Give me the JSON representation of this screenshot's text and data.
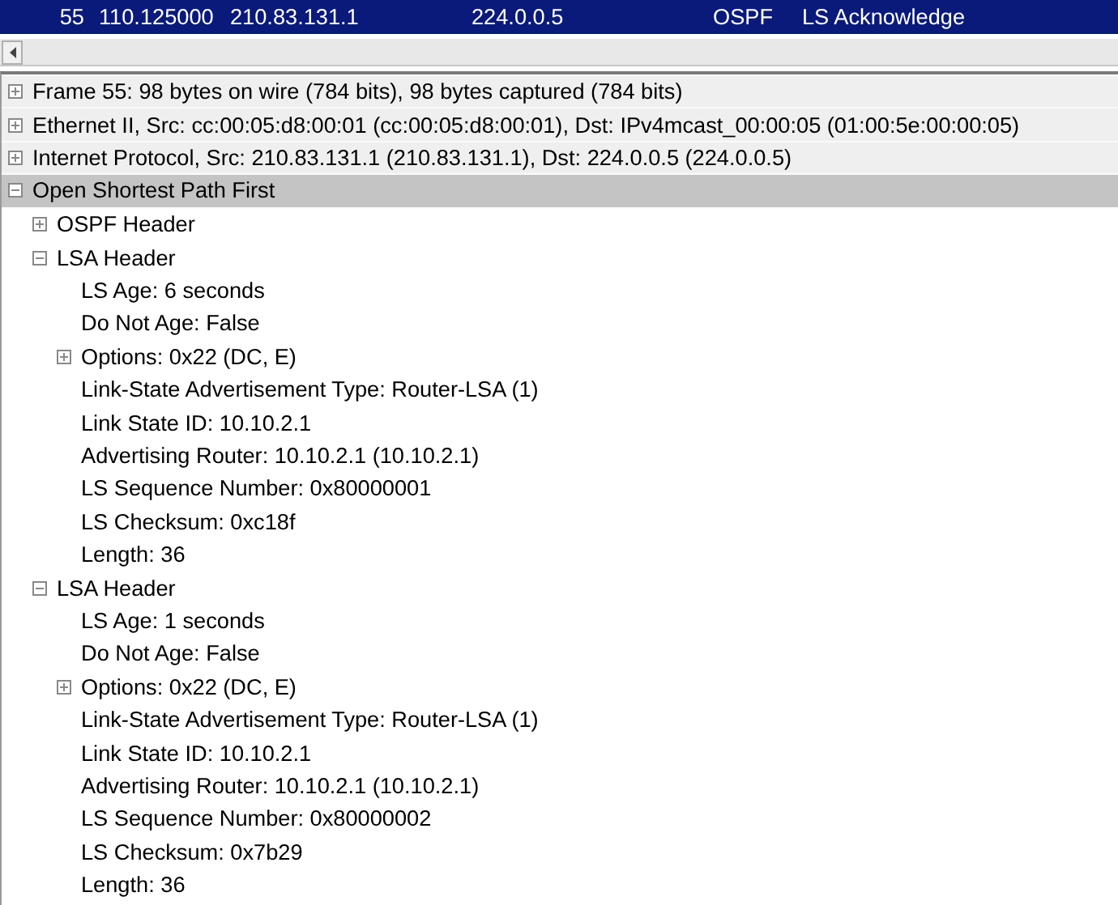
{
  "packet_list": {
    "rows": [
      {
        "cells": [
          "55",
          "110.125000",
          "210.83.131.1",
          "224.0.0.5",
          "OSPF",
          "LS Acknowledge"
        ],
        "selected": true
      }
    ]
  },
  "details_tree": {
    "items": [
      {
        "label": "Frame 55: 98 bytes on wire (784 bits), 98 bytes captured (784 bits)",
        "expanded": false,
        "selected": false
      },
      {
        "label": "Ethernet II, Src: cc:00:05:d8:00:01 (cc:00:05:d8:00:01), Dst: IPv4mcast_00:00:05 (01:00:5e:00:00:05)",
        "expanded": false,
        "selected": false
      },
      {
        "label": "Internet Protocol, Src: 210.83.131.1 (210.83.131.1), Dst: 224.0.0.5 (224.0.0.5)",
        "expanded": false,
        "selected": false
      },
      {
        "label": "Open Shortest Path First",
        "expanded": true,
        "selected": true,
        "children": [
          {
            "label": "OSPF Header",
            "expanded": false,
            "selected": false
          },
          {
            "label": "LSA Header",
            "expanded": true,
            "selected": false,
            "children": [
              {
                "label": "LS Age: 6 seconds",
                "selected": false
              },
              {
                "label": "Do Not Age: False",
                "selected": false
              },
              {
                "label": "Options: 0x22 (DC, E)",
                "expanded": false,
                "selected": false
              },
              {
                "label": "Link-State Advertisement Type: Router-LSA (1)",
                "selected": false
              },
              {
                "label": "Link State ID: 10.10.2.1",
                "selected": false
              },
              {
                "label": "Advertising Router: 10.10.2.1 (10.10.2.1)",
                "selected": false
              },
              {
                "label": "LS Sequence Number: 0x80000001",
                "selected": false
              },
              {
                "label": "LS Checksum: 0xc18f",
                "selected": false
              },
              {
                "label": "Length: 36",
                "selected": false
              }
            ]
          },
          {
            "label": "LSA Header",
            "expanded": true,
            "selected": false,
            "children": [
              {
                "label": "LS Age: 1 seconds",
                "selected": false
              },
              {
                "label": "Do Not Age: False",
                "selected": false
              },
              {
                "label": "Options: 0x22 (DC, E)",
                "expanded": false,
                "selected": false
              },
              {
                "label": "Link-State Advertisement Type: Router-LSA (1)",
                "selected": false
              },
              {
                "label": "Link State ID: 10.10.2.1",
                "selected": false
              },
              {
                "label": "Advertising Router: 10.10.2.1 (10.10.2.1)",
                "selected": false
              },
              {
                "label": "LS Sequence Number: 0x80000002",
                "selected": false
              },
              {
                "label": "LS Checksum: 0x7b29",
                "selected": false
              },
              {
                "label": "Length: 36",
                "selected": false
              }
            ]
          }
        ]
      }
    ]
  }
}
